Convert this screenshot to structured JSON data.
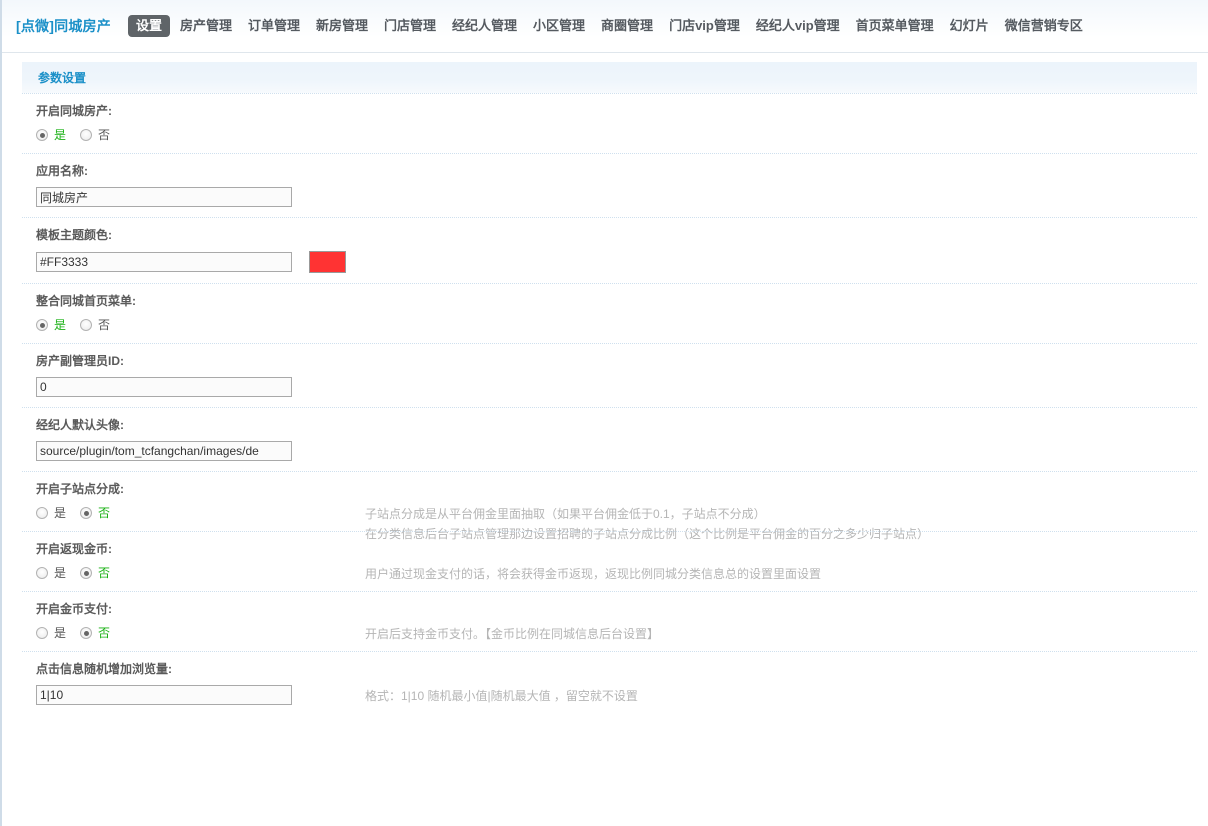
{
  "header": {
    "brand": "[点微]同城房产",
    "nav": [
      {
        "label": "设置",
        "active": true
      },
      {
        "label": "房产管理",
        "active": false
      },
      {
        "label": "订单管理",
        "active": false
      },
      {
        "label": "新房管理",
        "active": false
      },
      {
        "label": "门店管理",
        "active": false
      },
      {
        "label": "经纪人管理",
        "active": false
      },
      {
        "label": "小区管理",
        "active": false
      },
      {
        "label": "商圈管理",
        "active": false
      },
      {
        "label": "门店vip管理",
        "active": false
      },
      {
        "label": "经纪人vip管理",
        "active": false
      },
      {
        "label": "首页菜单管理",
        "active": false
      },
      {
        "label": "幻灯片",
        "active": false
      },
      {
        "label": "微信营销专区",
        "active": false
      }
    ]
  },
  "section": {
    "title": "参数设置"
  },
  "labels": {
    "yes": "是",
    "no": "否"
  },
  "colors": {
    "brand": "#1b90c8",
    "selected_label": "#18b013",
    "theme_swatch": "#FF3333",
    "active_tab_bg": "#5f6468"
  },
  "rows": [
    {
      "name": "enable-tongcheng-fangchan",
      "label": "开启同城房产:",
      "type": "radio",
      "selected": "yes",
      "help": []
    },
    {
      "name": "app-name",
      "label": "应用名称:",
      "type": "text",
      "value": "同城房产",
      "help": []
    },
    {
      "name": "template-theme-color",
      "label": "模板主题颜色:",
      "type": "color",
      "value": "#FF3333",
      "swatch": "#FF3333",
      "help": []
    },
    {
      "name": "merge-tongcheng-home-menu",
      "label": "整合同城首页菜单:",
      "type": "radio",
      "selected": "yes",
      "help": []
    },
    {
      "name": "fangchan-deputy-admin-id",
      "label": "房产副管理员ID:",
      "type": "text",
      "value": "0",
      "help": []
    },
    {
      "name": "agent-default-avatar",
      "label": "经纪人默认头像:",
      "type": "text",
      "value": "source/plugin/tom_tcfangchan/images/de",
      "help": []
    },
    {
      "name": "enable-subsite-commission",
      "label": "开启子站点分成:",
      "type": "radio",
      "selected": "no",
      "help": [
        "子站点分成是从平台佣金里面抽取（如果平台佣金低于0.1，子站点不分成）",
        "在分类信息后台子站点管理那边设置招聘的子站点分成比例（这个比例是平台佣金的百分之多少归子站点）"
      ]
    },
    {
      "name": "enable-cashback-coin",
      "label": "开启返现金币:",
      "type": "radio",
      "selected": "no",
      "help": [
        "用户通过现金支付的话，将会获得金币返现，返现比例同城分类信息总的设置里面设置"
      ]
    },
    {
      "name": "enable-coin-payment",
      "label": "开启金币支付:",
      "type": "radio",
      "selected": "no",
      "help": [
        "开启后支持金币支付。【金币比例在同城信息后台设置】"
      ]
    },
    {
      "name": "click-random-views",
      "label": "点击信息随机增加浏览量:",
      "type": "text",
      "value": "1|10",
      "help": [
        "格式：1|10 随机最小值|随机最大值 ，留空就不设置"
      ]
    }
  ]
}
